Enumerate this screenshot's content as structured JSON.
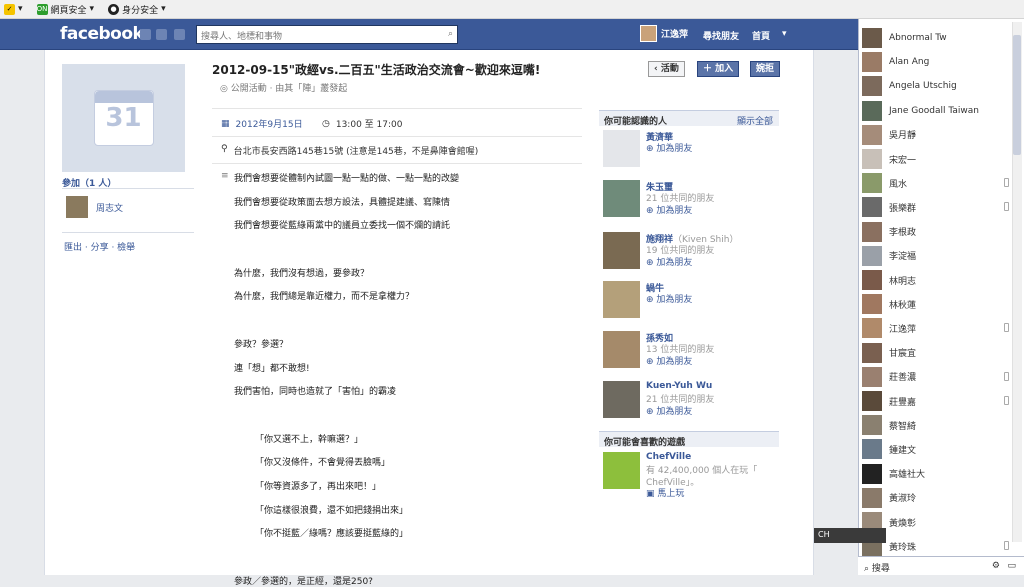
{
  "toolbar": {
    "items": [
      {
        "label": "",
        "icon": "norton-check-icon"
      },
      {
        "label": "網頁安全",
        "icon": "shield-icon"
      },
      {
        "label": "身分安全",
        "icon": "identity-icon"
      }
    ]
  },
  "header": {
    "logo": "facebook",
    "search_placeholder": "搜尋人、地標和事物",
    "user_name": "江逸萍",
    "nav": [
      "尋找朋友",
      "首頁"
    ],
    "brand_color": "#3b5998"
  },
  "left": {
    "cal_number": "31",
    "going_heading": "參加（1 人）",
    "attendee": "周志文",
    "links": "匯出 · 分享 · 檢舉"
  },
  "event": {
    "title": "2012-09-15\"政經vs.二百五\"生活政治交流會~歡迎來逗嘴!",
    "subtitle": "公開活動 · 由其「陣」叢發起",
    "btn_event": "活動",
    "btn_join": "加入",
    "btn_decline": "婉拒",
    "date": "2012年9月15日",
    "time": "13:00 至 17:00",
    "location": "台北市長安西路145巷15號 (注意是145巷，不是鼻陣會館喔)",
    "lines": [
      "我們會想要從體制內試圖一點一點的做、一點一點的改變",
      "我們會想要從政策面去想方設法，具體提建議、寫陳情",
      "我們會想要從藍綠兩黨中的議員立委找一個不爛的請託",
      "",
      "為什麼，我們沒有想過，要參政？",
      "為什麼，我們總是靠近權力，而不是拿權力？",
      "",
      "參政？參選？",
      "連「想」都不敢想!",
      "我們害怕，同時也造就了「害怕」的霸凌",
      "",
      "「你又選不上，幹嘛選？」",
      "「你又沒條件，不會覺得丟臉嗎」",
      "「你等資源多了，再出來吧！」",
      "「你這樣很浪費，還不如把錢捐出來」",
      "「你不挺藍／綠嗎？應該要挺藍綠的」",
      "",
      "參政／參選的，是正經，還是250?"
    ]
  },
  "suggest": {
    "people_heading": "你可能認識的人",
    "see_all": "顯示全部",
    "people": [
      {
        "name": "黃濟華",
        "alt": "",
        "mutual": "",
        "add": "加為朋友"
      },
      {
        "name": "朱玉璽",
        "alt": "",
        "mutual": "21 位共同的朋友",
        "add": "加為朋友"
      },
      {
        "name": "施翔祥",
        "alt": "（Kiven Shih）",
        "mutual": "19 位共同的朋友",
        "add": "加為朋友"
      },
      {
        "name": "蝸牛",
        "alt": "",
        "mutual": "",
        "add": "加為朋友"
      },
      {
        "name": "孫秀如",
        "alt": "",
        "mutual": "13 位共同的朋友",
        "add": "加為朋友"
      },
      {
        "name": "Kuen-Yuh Wu",
        "alt": "",
        "mutual": "21 位共同的朋友",
        "add": "加為朋友"
      }
    ],
    "games_heading": "你可能會喜歡的遊戲",
    "game_name": "ChefVille",
    "game_players": "有 42,400,000 個人在玩「",
    "game_players2": "ChefVille」。",
    "game_play": "馬上玩"
  },
  "chat": {
    "friends": [
      {
        "name": "Abnormal Tw",
        "mobile": false
      },
      {
        "name": "Alan Ang",
        "mobile": false
      },
      {
        "name": "Angela Utschig",
        "mobile": false
      },
      {
        "name": "Jane Goodall Taiwan",
        "mobile": false
      },
      {
        "name": "吳月靜",
        "mobile": false
      },
      {
        "name": "宋宏一",
        "mobile": false
      },
      {
        "name": "風水",
        "mobile": true
      },
      {
        "name": "張樂群",
        "mobile": true
      },
      {
        "name": "李根政",
        "mobile": false
      },
      {
        "name": "李淀福",
        "mobile": false
      },
      {
        "name": "林明志",
        "mobile": false
      },
      {
        "name": "林秋蓮",
        "mobile": false
      },
      {
        "name": "江逸萍",
        "mobile": true
      },
      {
        "name": "甘宸宜",
        "mobile": false
      },
      {
        "name": "莊善濃",
        "mobile": true
      },
      {
        "name": "莊豐嘉",
        "mobile": true
      },
      {
        "name": "蔡智綺",
        "mobile": false
      },
      {
        "name": "鍾建文",
        "mobile": false
      },
      {
        "name": "高雄社大",
        "mobile": false
      },
      {
        "name": "黃淑玲",
        "mobile": false
      },
      {
        "name": "黃煥彰",
        "mobile": false
      },
      {
        "name": "黃玲珠",
        "mobile": true
      }
    ],
    "search_label": "搜尋",
    "ime": "CH"
  }
}
